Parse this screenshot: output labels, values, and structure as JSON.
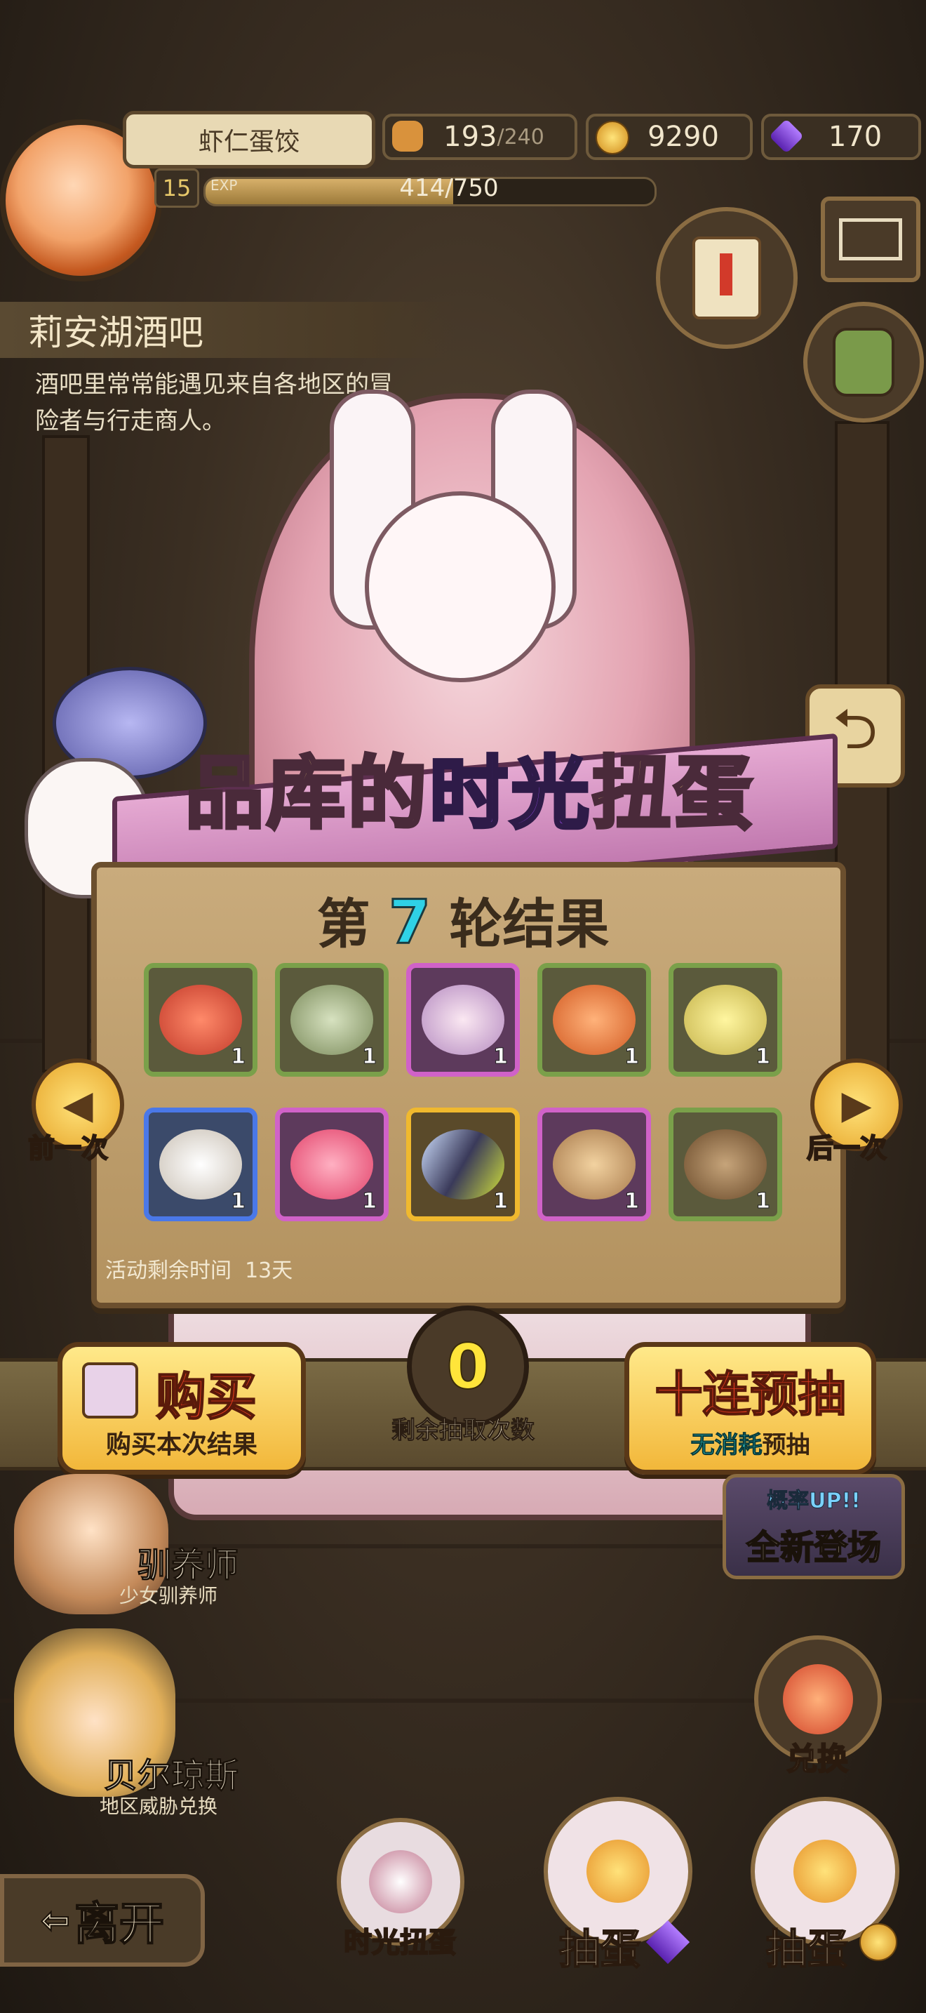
{
  "player": {
    "name": "虾仁蛋饺",
    "level": "15",
    "exp_label": "EXP",
    "exp_text": "414/750",
    "exp_fraction": 0.552
  },
  "resources": {
    "stamina": "193",
    "stamina_max": "/240",
    "gold": "9290",
    "gem": "170",
    "stamina_icon": "bread-icon",
    "gold_icon": "gold-coin-icon",
    "gem_icon": "purple-gem-icon"
  },
  "location": {
    "title": "莉安湖酒吧",
    "desc_line1": "酒吧里常常能遇见来自各地区的冒",
    "desc_line2": "险者与行走商人。"
  },
  "banner": {
    "part1": "品库的",
    "part2": "时光",
    "part3": "扭蛋"
  },
  "results": {
    "prefix": "第",
    "round": "7",
    "suffix": "轮结果",
    "items": [
      {
        "icon": "red-crab-icon",
        "qty": "1",
        "rarity": "green"
      },
      {
        "icon": "green-egg-icon",
        "qty": "1",
        "rarity": "green"
      },
      {
        "icon": "bat-egg-icon",
        "qty": "1",
        "rarity": "purple"
      },
      {
        "icon": "orange-creature-icon",
        "qty": "1",
        "rarity": "green"
      },
      {
        "icon": "yellow-egg-icon",
        "qty": "1",
        "rarity": "green"
      },
      {
        "icon": "wool-horn-icon",
        "qty": "1",
        "rarity": "blue"
      },
      {
        "icon": "jelly-crown-icon",
        "qty": "1",
        "rarity": "purple"
      },
      {
        "icon": "moth-wing-icon",
        "qty": "1",
        "rarity": "gold"
      },
      {
        "icon": "flower-creature-icon",
        "qty": "1",
        "rarity": "purple"
      },
      {
        "icon": "wooden-egg-icon",
        "qty": "1",
        "rarity": "green"
      }
    ],
    "event_time_label": "活动剩余时间",
    "event_time_value": "13天"
  },
  "nav": {
    "prev": "前一次",
    "next": "后一次",
    "prev_icon": "left-arrow-icon",
    "next_icon": "right-arrow-icon"
  },
  "actions": {
    "buy_title": "购买",
    "buy_sub": "购买本次结果",
    "counter": "0",
    "counter_label": "剩余抽取次数",
    "preview_title": "十连预抽",
    "preview_sub_a": "无消耗",
    "preview_sub_b": "预抽"
  },
  "npcs": [
    {
      "name": "驯养师",
      "sub": "少女驯养师"
    },
    {
      "name": "贝尔琼斯",
      "sub": "地区威胁兑换"
    }
  ],
  "right_menu": {
    "new_badge_top": "概率UP!!",
    "new_badge": "全新登场",
    "exchange": "兑换"
  },
  "bottom": {
    "leave": "离开",
    "time_gacha": "时光扭蛋",
    "draw1": "抽蛋",
    "draw2": "抽蛋"
  },
  "colors": {
    "accent_gold": "#f2b73a",
    "title_purple": "#9b4cf0",
    "round_cyan": "#2fd1e6",
    "counter_yellow": "#ffe53a"
  }
}
